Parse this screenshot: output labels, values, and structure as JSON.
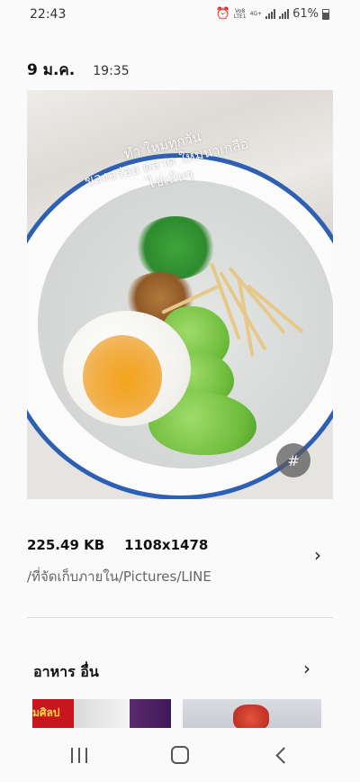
{
  "status_bar": {
    "time": "22:43",
    "network_top": "Vo8",
    "network_bottom": "LTE1",
    "gen_label": "4G+",
    "battery": "61%"
  },
  "header": {
    "date": "9 ม.ค.",
    "time": "19:35"
  },
  "photo": {
    "overlay_line1": "ทำ ใหม่ทุกวัน",
    "overlay_line2": "ของอร่อย ตลาด ใหม่นาเกลือ",
    "overlay_line3": "ไข่เน้นๆ",
    "tag_label": "#"
  },
  "details": {
    "size": "225.49 KB",
    "resolution": "1108x1478",
    "path": "/ที่จัดเก็บภายใน/Pictures/LINE"
  },
  "related": {
    "title": "อาหาร อื่น",
    "thumb1_sign": "มศิลป"
  },
  "icons": {
    "chevron": "chevron-right-icon",
    "tag": "hashtag-icon",
    "alarm": "alarm-icon"
  },
  "colors": {
    "bowl_rim": "#2d5fb3",
    "background": "#fafafa"
  }
}
